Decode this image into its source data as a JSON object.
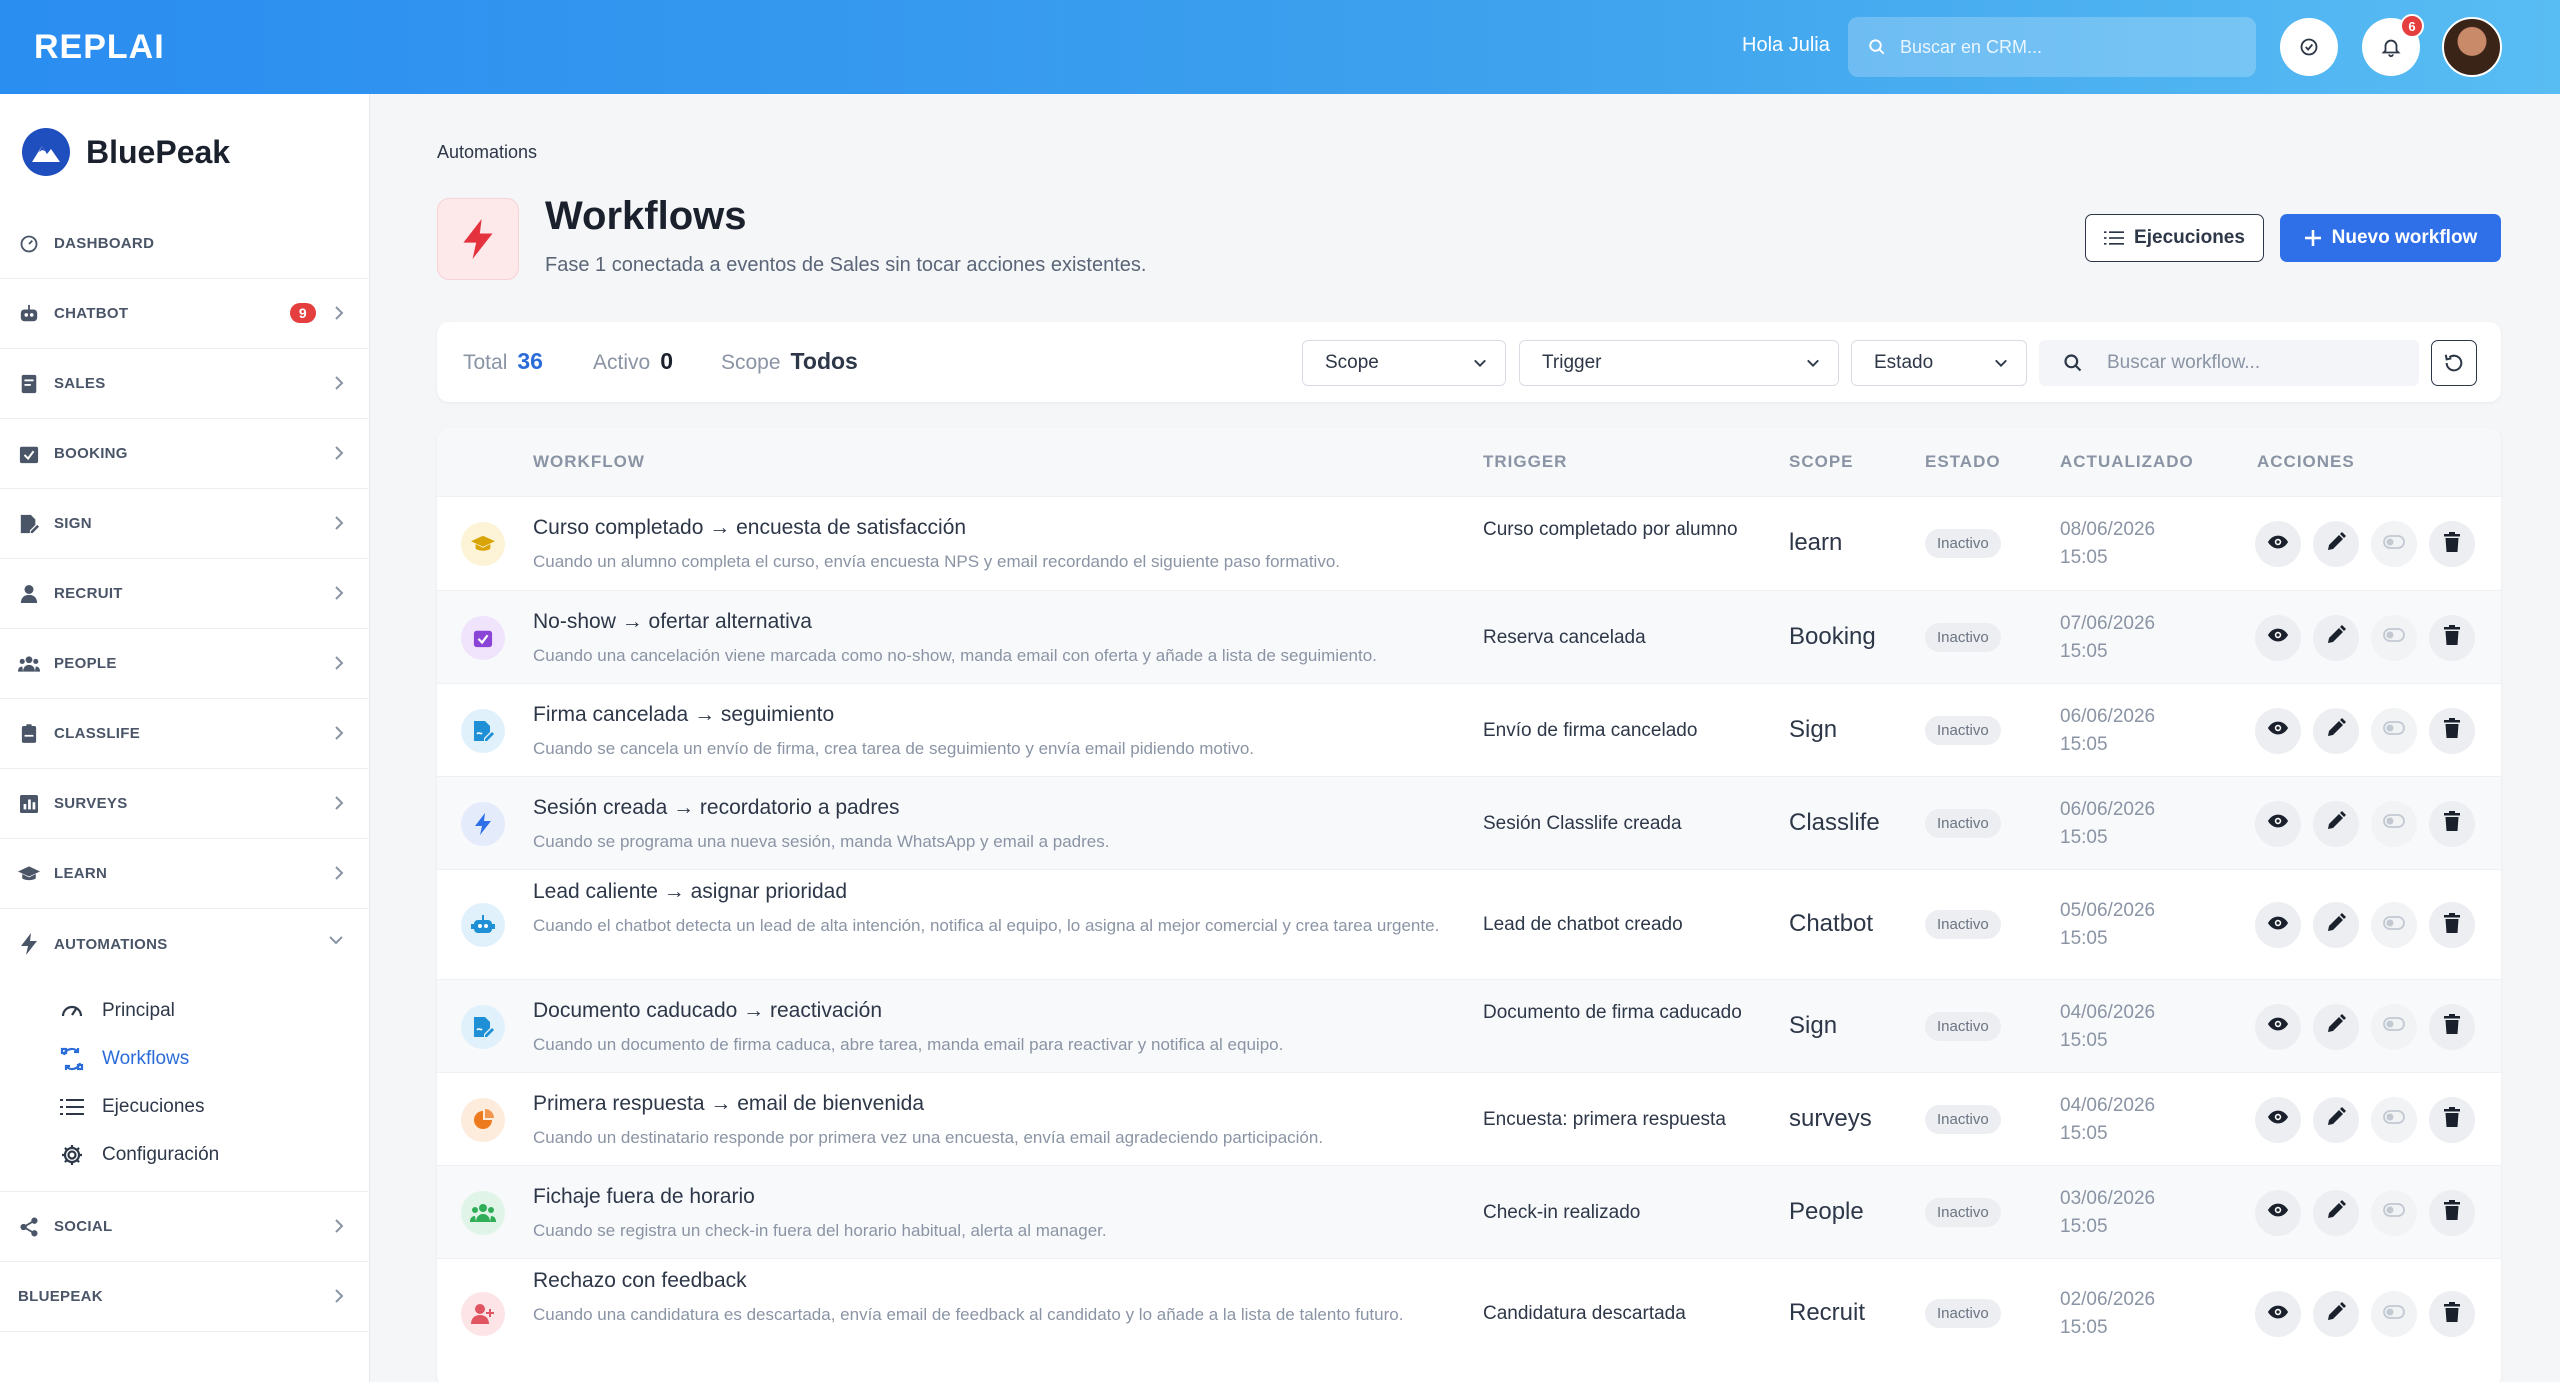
{
  "topbar": {
    "logo": "REPLAI",
    "greeting": "Hola Julia",
    "search_placeholder": "Buscar en CRM...",
    "notif_count": "6"
  },
  "sidebar": {
    "brand": "BluePeak",
    "items": [
      {
        "label": "DASHBOARD"
      },
      {
        "label": "CHATBOT",
        "badge": "9"
      },
      {
        "label": "SALES"
      },
      {
        "label": "BOOKING"
      },
      {
        "label": "SIGN"
      },
      {
        "label": "RECRUIT"
      },
      {
        "label": "PEOPLE"
      },
      {
        "label": "CLASSLIFE"
      },
      {
        "label": "SURVEYS"
      },
      {
        "label": "LEARN"
      },
      {
        "label": "AUTOMATIONS"
      }
    ],
    "sub": [
      {
        "label": "Principal"
      },
      {
        "label": "Workflows"
      },
      {
        "label": "Ejecuciones"
      },
      {
        "label": "Configuración"
      }
    ],
    "bottom": [
      {
        "label": "SOCIAL"
      },
      {
        "label": "BLUEPEAK"
      }
    ]
  },
  "breadcrumb": "Automations",
  "header": {
    "title": "Workflows",
    "subtitle": "Fase 1 conectada a eventos de Sales sin tocar acciones existentes.",
    "btn_ejecuciones": "Ejecuciones",
    "btn_nuevo": "Nuevo workflow"
  },
  "filters": {
    "total_label": "Total",
    "total_value": "36",
    "activo_label": "Activo",
    "activo_value": "0",
    "scope_label": "Scope",
    "scope_value": "Todos",
    "sel_scope": "Scope",
    "sel_trigger": "Trigger",
    "sel_estado": "Estado",
    "search_placeholder": "Buscar workflow..."
  },
  "table": {
    "headers": {
      "workflow": "WORKFLOW",
      "trigger": "TRIGGER",
      "scope": "SCOPE",
      "estado": "ESTADO",
      "actualizado": "ACTUALIZADO",
      "acciones": "ACCIONES"
    },
    "rows": [
      {
        "title": "Curso completado → encuesta de satisfacción",
        "desc": "Cuando un alumno completa el curso, envía encuesta NPS y email recordando el siguiente paso formativo.",
        "trigger": "Curso completado por alumno",
        "scope": "learn",
        "estado": "Inactivo",
        "date": "08/06/2026",
        "time": "15:05",
        "icon": "graduation-cap-icon",
        "color": "#d9a406",
        "bg": "#fdf4d8"
      },
      {
        "title": "No-show → ofertar alternativa",
        "desc": "Cuando una cancelación viene marcada como no-show, manda email con oferta y añade a lista de seguimiento.",
        "trigger": "Reserva cancelada",
        "scope": "Booking",
        "estado": "Inactivo",
        "date": "07/06/2026",
        "time": "15:05",
        "icon": "calendar-check-icon",
        "color": "#8b45d6",
        "bg": "#efe4fb"
      },
      {
        "title": "Firma cancelada → seguimiento",
        "desc": "Cuando se cancela un envío de firma, crea tarea de seguimiento y envía email pidiendo motivo.",
        "trigger": "Envío de firma cancelado",
        "scope": "Sign",
        "estado": "Inactivo",
        "date": "06/06/2026",
        "time": "15:05",
        "icon": "file-signature-icon",
        "color": "#1f8fd6",
        "bg": "#e1f1fb"
      },
      {
        "title": "Sesión creada → recordatorio a padres",
        "desc": "Cuando se programa una nueva sesión, manda WhatsApp y email a padres.",
        "trigger": "Sesión Classlife creada",
        "scope": "Classlife",
        "estado": "Inactivo",
        "date": "06/06/2026",
        "time": "15:05",
        "icon": "bolt-icon",
        "color": "#2f6fe8",
        "bg": "#e4ecfc"
      },
      {
        "title": "Lead caliente → asignar prioridad",
        "desc": "Cuando el chatbot detecta un lead de alta intención, notifica al equipo, lo asigna al mejor comercial y crea tarea urgente.",
        "trigger": "Lead de chatbot creado",
        "scope": "Chatbot",
        "estado": "Inactivo",
        "date": "05/06/2026",
        "time": "15:05",
        "icon": "robot-icon",
        "color": "#1f8fd6",
        "bg": "#e1f1fb"
      },
      {
        "title": "Documento caducado → reactivación",
        "desc": "Cuando un documento de firma caduca, abre tarea, manda email para reactivar y notifica al equipo.",
        "trigger": "Documento de firma caducado",
        "scope": "Sign",
        "estado": "Inactivo",
        "date": "04/06/2026",
        "time": "15:05",
        "icon": "file-signature-icon",
        "color": "#1f8fd6",
        "bg": "#e1f1fb"
      },
      {
        "title": "Primera respuesta → email de bienvenida",
        "desc": "Cuando un destinatario responde por primera vez una encuesta, envía email agradeciendo participación.",
        "trigger": "Encuesta: primera respuesta",
        "scope": "surveys",
        "estado": "Inactivo",
        "date": "04/06/2026",
        "time": "15:05",
        "icon": "pie-chart-icon",
        "color": "#ee7a1e",
        "bg": "#fdebdc"
      },
      {
        "title": "Fichaje fuera de horario",
        "desc": "Cuando se registra un check-in fuera del horario habitual, alerta al manager.",
        "trigger": "Check-in realizado",
        "scope": "People",
        "estado": "Inactivo",
        "date": "03/06/2026",
        "time": "15:05",
        "icon": "users-icon",
        "color": "#2fae57",
        "bg": "#e0f5e7"
      },
      {
        "title": "Rechazo con feedback",
        "desc": "Cuando una candidatura es descartada, envía email de feedback al candidato y lo añade a la lista de talento futuro.",
        "trigger": "Candidatura descartada",
        "scope": "Recruit",
        "estado": "Inactivo",
        "date": "02/06/2026",
        "time": "15:05",
        "icon": "user-plus-icon",
        "color": "#e05561",
        "bg": "#fde4e6"
      }
    ]
  },
  "colors": {
    "accent": "#2f6fe8",
    "danger": "#e53e3e"
  }
}
